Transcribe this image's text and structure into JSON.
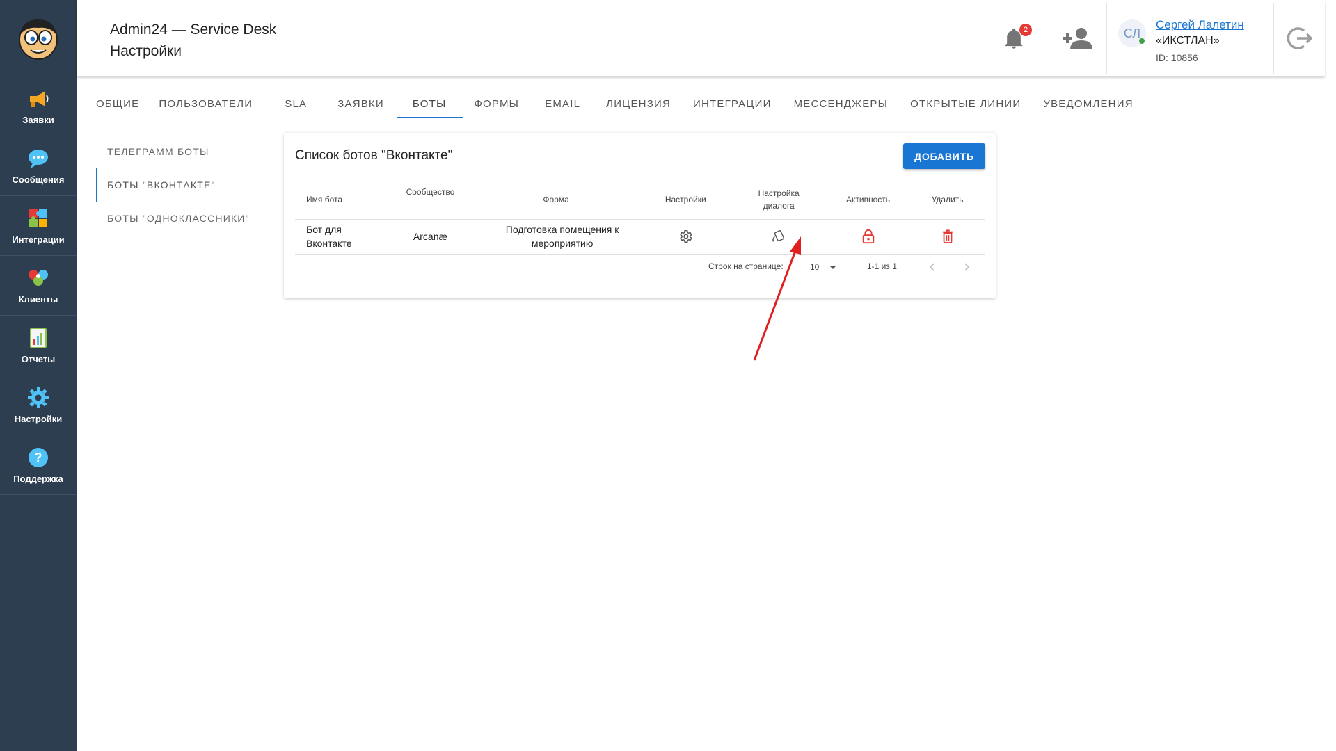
{
  "app": {
    "title": "Admin24 — Service Desk",
    "page": "Настройки"
  },
  "sidebar": {
    "items": [
      {
        "label": "Заявки",
        "icon": "megaphone-icon"
      },
      {
        "label": "Сообщения",
        "icon": "chat-bubble-icon"
      },
      {
        "label": "Интеграции",
        "icon": "puzzle-icon"
      },
      {
        "label": "Клиенты",
        "icon": "clients-icon"
      },
      {
        "label": "Отчеты",
        "icon": "report-icon"
      },
      {
        "label": "Настройки",
        "icon": "gear-icon"
      },
      {
        "label": "Поддержка",
        "icon": "help-icon"
      }
    ]
  },
  "header": {
    "notifications_count": "2",
    "user": {
      "initials": "СЛ",
      "name": "Сергей Лалетин",
      "org": "«ИКСТЛАН»",
      "id": "ID: 10856"
    }
  },
  "tabs": [
    {
      "label": "ОБЩИЕ"
    },
    {
      "label": "ПОЛЬЗОВАТЕЛИ"
    },
    {
      "label": "SLA"
    },
    {
      "label": "ЗАЯВКИ"
    },
    {
      "label": "БОТЫ",
      "active": true
    },
    {
      "label": "ФОРМЫ"
    },
    {
      "label": "EMAIL"
    },
    {
      "label": "ЛИЦЕНЗИЯ"
    },
    {
      "label": "ИНТЕГРАЦИИ"
    },
    {
      "label": "МЕССЕНДЖЕРЫ"
    },
    {
      "label": "ОТКРЫТЫЕ ЛИНИИ"
    },
    {
      "label": "УВЕДОМЛЕНИЯ"
    }
  ],
  "subnav": [
    {
      "label": "ТЕЛЕГРАММ БОТЫ"
    },
    {
      "label": "БОТЫ \"ВКОНТАКТЕ\"",
      "active": true
    },
    {
      "label": "БОТЫ \"ОДНОКЛАССНИКИ\""
    }
  ],
  "card": {
    "title": "Список ботов \"Вконтакте\"",
    "add_label": "ДОБАВИТЬ",
    "columns": [
      "Имя бота",
      "Сообщество",
      "Форма",
      "Настройки",
      "Настройка диалога",
      "Активность",
      "Удалить"
    ],
    "rows": [
      {
        "name": "Бот для Вконтакте",
        "community": "Arcanæ",
        "form": "Подготовка помещения к мероприятию"
      }
    ],
    "pagination": {
      "rows_label": "Строк на странице:",
      "rows_value": "10",
      "range": "1-1 из 1"
    }
  },
  "colors": {
    "sidebar": "#2c3e50",
    "accent": "#1976d2",
    "danger": "#e53935",
    "annotation_arrow": "#e02020"
  }
}
